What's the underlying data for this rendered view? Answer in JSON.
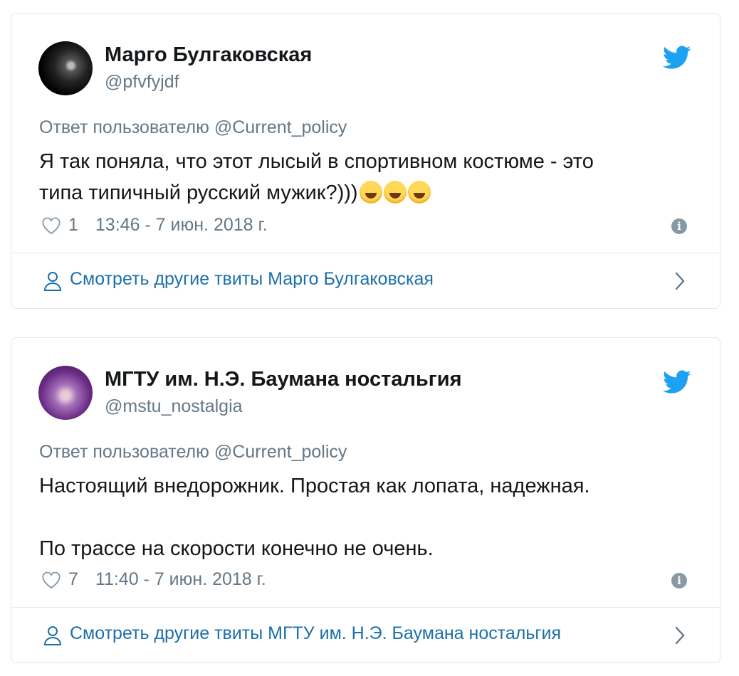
{
  "tweets": [
    {
      "name": "Марго Булгаковская",
      "handle": "@pfvfyjdf",
      "reply_to": "Ответ пользователю @Current_policy",
      "text_lines": [
        "Я так поняла, что этот лысый в спортивном костюме - это",
        "типа типичный русский мужик?)))"
      ],
      "emoji": [
        "rolling-on-floor-laughing",
        "rolling-on-floor-laughing",
        "rolling-on-floor-laughing"
      ],
      "likes": "1",
      "timestamp": "13:46 - 7 июн. 2018 г.",
      "footer_label": "Смотреть другие твиты Марго Булгаковская"
    },
    {
      "name": "МГТУ им. Н.Э. Баумана ностальгия",
      "handle": "@mstu_nostalgia",
      "reply_to": "Ответ пользователю @Current_policy",
      "text_lines": [
        "Настоящий внедорожник. Простая как лопата, надежная.",
        "",
        "По трассе на скорости конечно не очень."
      ],
      "likes": "7",
      "timestamp": "11:40 - 7 июн. 2018 г.",
      "footer_label": "Смотреть другие твиты МГТУ им. Н.Э. Баумана ностальгия"
    }
  ],
  "icons": {
    "brand": "twitter-bird-icon",
    "like": "heart-icon",
    "info": "info-icon",
    "profile": "user-icon",
    "more": "chevron-right-icon"
  },
  "colors": {
    "twitter_blue": "#1da1f2",
    "link_blue": "#1b6fab",
    "secondary_text": "#657786",
    "border": "#e1e8ed"
  }
}
